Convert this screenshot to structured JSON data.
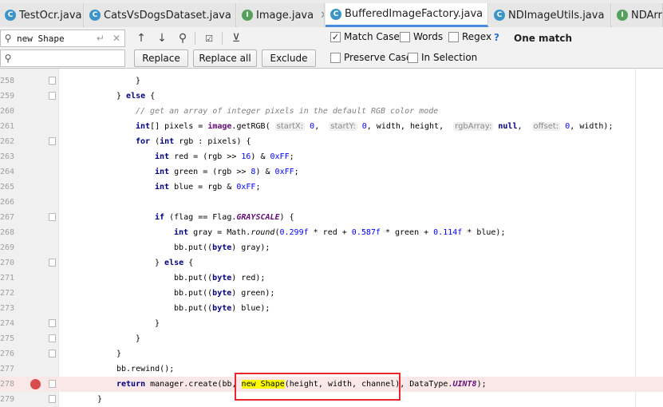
{
  "tabs": [
    {
      "label": "TestOcr.java",
      "icon": "class-icon",
      "active": false
    },
    {
      "label": "CatsVsDogsDataset.java",
      "icon": "class-icon",
      "active": false
    },
    {
      "label": "Image.java",
      "icon": "interface-icon",
      "active": false
    },
    {
      "label": "BufferedImageFactory.java",
      "icon": "class-icon",
      "active": true
    },
    {
      "label": "NDImageUtils.java",
      "icon": "class-icon",
      "active": false
    },
    {
      "label": "NDArr",
      "icon": "interface-icon",
      "active": false
    }
  ],
  "find": {
    "search_value": "new Shape",
    "replace_value": "",
    "match_case_label": "Match Case",
    "words_label": "Words",
    "regex_label": "Regex",
    "help_label": "?",
    "match_count": "One match",
    "replace_label": "Replace",
    "replace_all_label": "Replace all",
    "exclude_label": "Exclude",
    "preserve_case_label": "Preserve Case",
    "in_selection_label": "In Selection",
    "match_case_checked": true,
    "words_checked": false,
    "regex_checked": false,
    "preserve_case_checked": false,
    "in_selection_checked": false
  },
  "editor": {
    "line_numbers": [
      "258",
      "259",
      "260",
      "261",
      "262",
      "263",
      "264",
      "265",
      "266",
      "267",
      "268",
      "269",
      "270",
      "271",
      "272",
      "273",
      "274",
      "275",
      "276",
      "277",
      "278",
      "279"
    ],
    "breakpoint_line": "278",
    "highlighted_match": "new Shape",
    "hints": {
      "startX": "startX:",
      "startY": "startY:",
      "rgbArray": "rgbArray:",
      "offset": "offset:"
    }
  },
  "colors": {
    "keyword": "#000080",
    "number": "#0000ff",
    "comment": "#808080",
    "static_field": "#660e7a",
    "match_highlight": "#ffff00",
    "error_line_bg": "#fae8e8",
    "breakpoint": "#d94c4c",
    "annotation_box": "#e8262c",
    "active_tab_underline": "#4c8ce0"
  }
}
